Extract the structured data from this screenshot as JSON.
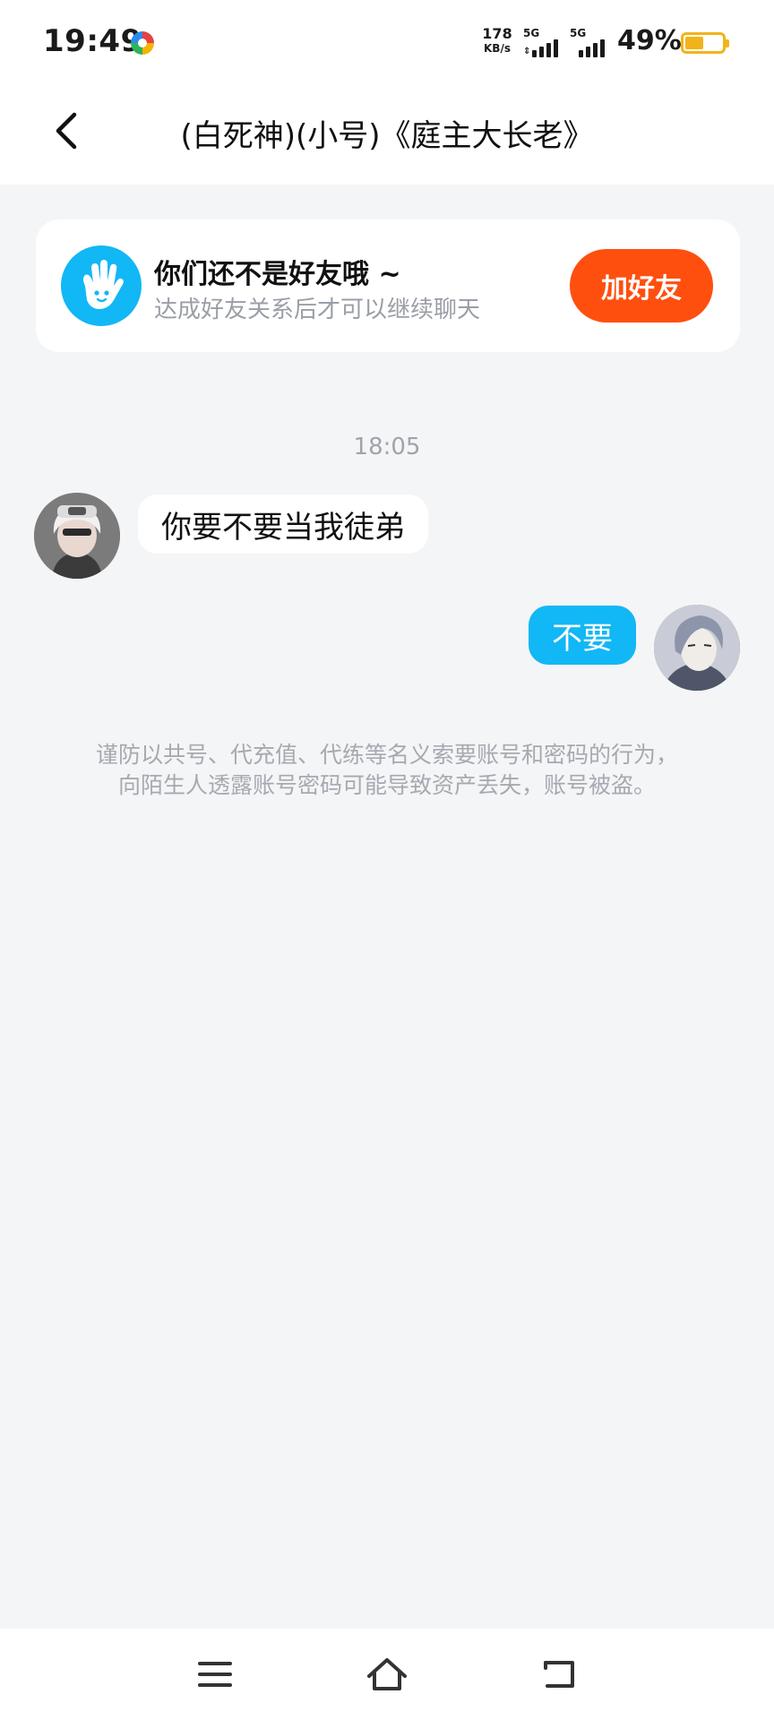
{
  "status_bar": {
    "time": "19:49",
    "app_icon": "colorful-circle-app-icon",
    "net_speed_value": "178",
    "net_speed_unit": "KB/s",
    "sim1_label": "5G",
    "sim2_label": "5G",
    "battery_percent": "49%",
    "battery_level": 0.49,
    "battery_color": "#f2b31a"
  },
  "header": {
    "back_icon": "chevron-left-icon",
    "title": "(白死神)(小号)《庭主大长老》"
  },
  "friend_banner": {
    "icon": "waving-hand-icon",
    "icon_color": "#12b7f5",
    "title": "你们还不是好友哦 ~",
    "subtitle": "达成好友关系后才可以继续聊天",
    "button_label": "加好友",
    "button_color": "#ff4f0f"
  },
  "chat": {
    "timestamp": "18:05",
    "messages": [
      {
        "direction": "incoming",
        "text": "你要不要当我徒弟"
      },
      {
        "direction": "outgoing",
        "text": "不要"
      }
    ],
    "outgoing_bubble_color": "#12b7f5"
  },
  "safety_notice": {
    "line1": "谨防以共号、代充值、代练等名义索要账号和密码的行为，",
    "line2": "向陌生人透露账号密码可能导致资产丢失，账号被盗。"
  },
  "nav_bar": {
    "menu_icon": "menu-icon",
    "home_icon": "home-icon",
    "back_icon": "back-return-icon"
  }
}
